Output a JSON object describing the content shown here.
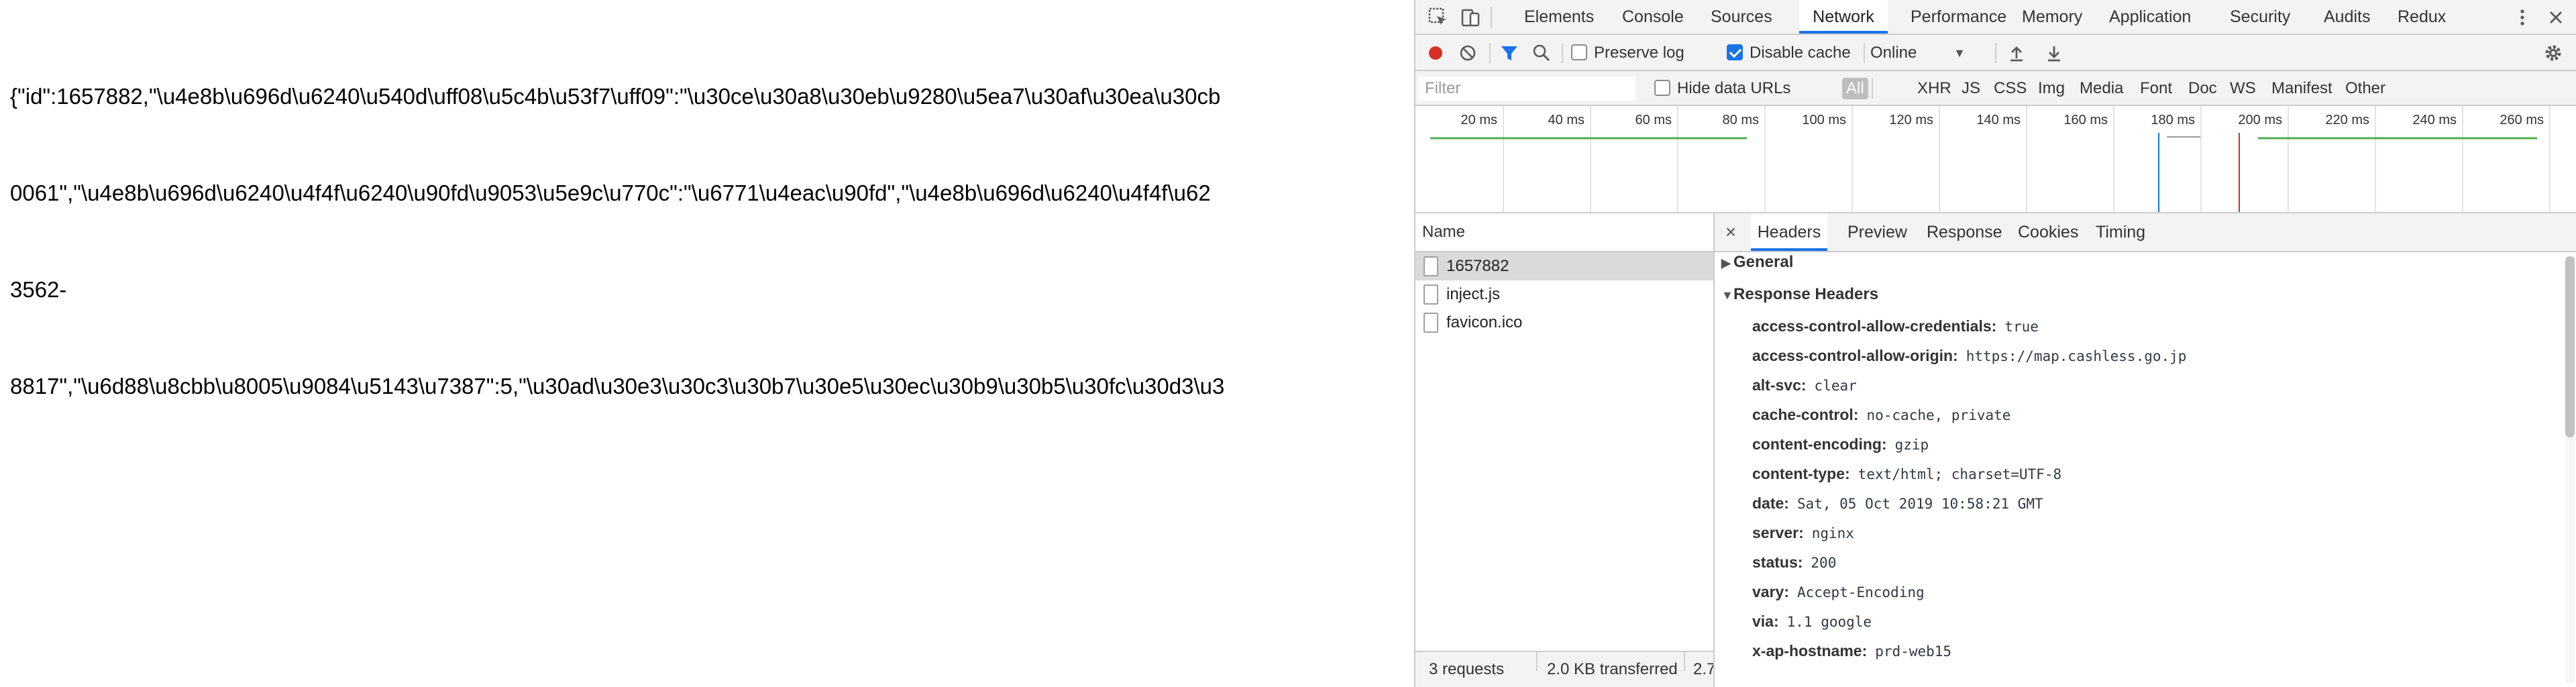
{
  "page": {
    "json_lines": [
      "{\"id\":1657882,\"\\u4e8b\\u696d\\u6240\\u540d\\uff08\\u5c4b\\u53f7\\uff09\":\"\\u30ce\\u30a8\\u30eb\\u9280\\u5ea7\\u30af\\u30ea\\u30cb",
      "0061\",\"\\u4e8b\\u696d\\u6240\\u4f4f\\u6240\\u90fd\\u9053\\u5e9c\\u770c\":\"\\u6771\\u4eac\\u90fd\",\"\\u4e8b\\u696d\\u6240\\u4f4f\\u62",
      "3562-",
      "8817\",\"\\u6d88\\u8cbb\\u8005\\u9084\\u5143\\u7387\":5,\"\\u30ad\\u30e3\\u30c3\\u30b7\\u30e5\\u30ec\\u30b9\\u30b5\\u30fc\\u30d3\\u3"
    ]
  },
  "devtools": {
    "tabs": [
      "Elements",
      "Console",
      "Sources",
      "Network",
      "Performance",
      "Memory",
      "Application",
      "Security",
      "Audits",
      "Redux"
    ],
    "active_tab": "Network",
    "toolbar": {
      "preserve_log": "Preserve log",
      "disable_cache": "Disable cache",
      "throttle": "Online"
    },
    "filter": {
      "placeholder": "Filter",
      "hide_data_urls": "Hide data URLs",
      "types": [
        "All",
        "XHR",
        "JS",
        "CSS",
        "Img",
        "Media",
        "Font",
        "Doc",
        "WS",
        "Manifest",
        "Other"
      ]
    },
    "overview": {
      "ticks": [
        "20 ms",
        "40 ms",
        "60 ms",
        "80 ms",
        "100 ms",
        "120 ms",
        "140 ms",
        "160 ms",
        "180 ms",
        "200 ms",
        "220 ms",
        "240 ms",
        "260 ms"
      ]
    },
    "name_column": "Name",
    "requests": [
      "1657882",
      "inject.js",
      "favicon.ico"
    ],
    "status": {
      "requests": "3 requests",
      "transferred": "2.0 KB transferred",
      "extra": "2.7"
    },
    "detail_tabs": [
      "Headers",
      "Preview",
      "Response",
      "Cookies",
      "Timing"
    ],
    "sections": {
      "general": "General",
      "response_headers": "Response Headers"
    },
    "headers": [
      {
        "key": "access-control-allow-credentials:",
        "value": "true"
      },
      {
        "key": "access-control-allow-origin:",
        "value": "https://map.cashless.go.jp"
      },
      {
        "key": "alt-svc:",
        "value": "clear"
      },
      {
        "key": "cache-control:",
        "value": "no-cache, private"
      },
      {
        "key": "content-encoding:",
        "value": "gzip"
      },
      {
        "key": "content-type:",
        "value": "text/html; charset=UTF-8"
      },
      {
        "key": "date:",
        "value": "Sat, 05 Oct 2019 10:58:21 GMT"
      },
      {
        "key": "server:",
        "value": "nginx"
      },
      {
        "key": "status:",
        "value": "200"
      },
      {
        "key": "vary:",
        "value": "Accept-Encoding"
      },
      {
        "key": "via:",
        "value": "1.1 google"
      },
      {
        "key": "x-ap-hostname:",
        "value": "prd-web15"
      }
    ],
    "colors": {
      "accent": "#1a73e8",
      "record": "#d93025",
      "waterfall_green": "#4caf50",
      "dom_content_loaded": "#1a73e8",
      "load_event": "#c0392b"
    }
  }
}
